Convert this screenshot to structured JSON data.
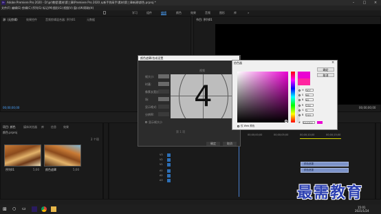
{
  "window": {
    "title": "Adobe Premiere Pro 2020 - D:\\pr\\教程\\素材\\第三章\\Premiere Pro 2020 从新手到高手\\素材\\第三章新建\\颜色.prproj *",
    "app_icon": "Pr"
  },
  "menu": [
    "文件(F)",
    "编辑(E)",
    "剪辑(C)",
    "序列(S)",
    "标记(M)",
    "图形(G)",
    "视图(V)",
    "窗口(W)",
    "帮助(H)"
  ],
  "workspaces": [
    "学习",
    "组件",
    "编辑",
    "颜色",
    "效果",
    "音频",
    "图形",
    "库"
  ],
  "active_workspace": "编辑",
  "source_panel": {
    "tabs": [
      "源: (无剪辑)",
      "效果控件",
      "音频剪辑混合器: 序列01",
      "元数据"
    ],
    "timecode_left": "00;00;00;00"
  },
  "program_panel": {
    "tab": "节目: 序列01",
    "timecode_right": "00;00;00;00"
  },
  "project_panel": {
    "tabs": [
      "项目: 颜色",
      "媒体浏览器",
      "库",
      "信息",
      "效果"
    ],
    "file": "颜色.prproj",
    "count": "2 个项",
    "items": [
      {
        "name": "序列01",
        "duration": "5;00"
      },
      {
        "name": "颜色遮罩",
        "duration": "5;00"
      }
    ]
  },
  "timeline": {
    "ticks": [
      "00;00;00;00",
      "00;00;05;00",
      "00;00;10;00",
      "00;00;15;00"
    ],
    "tracks": [
      "V3",
      "V2",
      "V1",
      "A1",
      "A2",
      "A3"
    ],
    "clip_labels": [
      "颜色遮罩",
      "颜色遮罩"
    ]
  },
  "matte_dialog": {
    "title": "颜色遮罩/合成设置",
    "section": "视频",
    "rows": [
      "帧大小:",
      "时基:",
      "像素长宽比:",
      "场:",
      "显示格式:",
      "分辨率:"
    ],
    "checkbox_label": "显示帧大小",
    "dropdown_label": "第 1 项",
    "ok": "确定",
    "cancel": "取消",
    "countdown_digit": "4"
  },
  "color_picker": {
    "title": "拾色器",
    "ok": "确定",
    "cancel": "取消",
    "hsb_labels": [
      "H",
      "S",
      "B",
      "R",
      "G",
      "B"
    ],
    "hsb_values": [
      "307",
      "99",
      "92",
      "234",
      "2",
      "210"
    ],
    "hex_label": "#",
    "hex": "EA02D2",
    "web_colors_label": "仅 Web 颜色",
    "current_color": "#ea02d2",
    "original_color": "#ff24a0"
  },
  "watermark": "最需教育",
  "taskbar": {
    "time": "15:01",
    "date": "2021/1/24",
    "icons": [
      "windows-icon",
      "search-icon",
      "taskview-icon",
      "premiere-icon",
      "chrome-icon",
      "folder-icon"
    ]
  }
}
